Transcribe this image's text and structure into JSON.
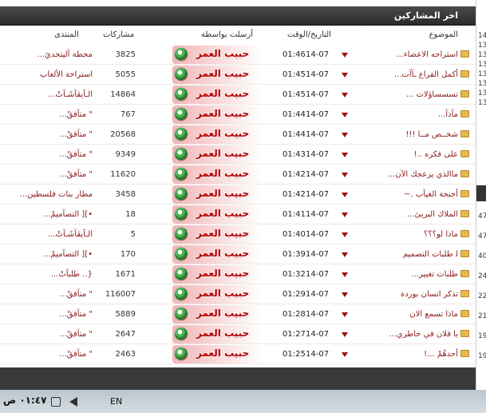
{
  "header": {
    "title": "اخر المشاركين"
  },
  "columns": {
    "topic": "الموضوع",
    "datetime": "التاريخ/الوقت",
    "sender": "أرسلت بواسطة",
    "posts": "مشاركات",
    "forum": "المنتدى"
  },
  "rows": [
    {
      "topic": "استراحه الاعضاء...",
      "date": "14-07",
      "time": "01:46",
      "user": "حبيب العمر",
      "posts": "3825",
      "forum": "محطة آليتجديَ..."
    },
    {
      "topic": "أكمل الفراغ ـآآت...",
      "date": "14-07",
      "time": "01:45",
      "user": "حبيب العمر",
      "posts": "5055",
      "forum": "استراحة الألعاب"
    },
    {
      "topic": "تسسساؤلات ...",
      "date": "14-07",
      "time": "01:45",
      "user": "حبيب العمر",
      "posts": "14864",
      "forum": "الـاَيڤآشَـآتْ..."
    },
    {
      "topic": "مآذآ...",
      "date": "14-07",
      "time": "01:44",
      "user": "حبيب العمر",
      "posts": "767",
      "forum": "\" متآفقْ..."
    },
    {
      "topic": "شخــص مــا !!!",
      "date": "14-07",
      "time": "01:44",
      "user": "حبيب العمر",
      "posts": "20568",
      "forum": "\" متآفقْ..."
    },
    {
      "topic": "على فكره ..!",
      "date": "14-07",
      "time": "01:43",
      "user": "حبيب العمر",
      "posts": "9349",
      "forum": "\" متآفقْ..."
    },
    {
      "topic": "ماالذي يزعجك الآن...",
      "date": "14-07",
      "time": "01:42",
      "user": "حبيب العمر",
      "posts": "11620",
      "forum": "\" متآفقْ..."
    },
    {
      "topic": "أجنحة الغيآب .~",
      "date": "14-07",
      "time": "01:42",
      "user": "حبيب العمر",
      "posts": "3458",
      "forum": "مطار بنات فلسطين..."
    },
    {
      "topic": "الملاك البريئ...",
      "date": "14-07",
      "time": "01:41",
      "user": "حبيب العمر",
      "posts": "18",
      "forum": "•][ التصآميمْ..."
    },
    {
      "topic": "ماذا لو؟؟؟",
      "date": "14-07",
      "time": "01:40",
      "user": "حبيب العمر",
      "posts": "5",
      "forum": "الـاَيڤآشَـآتْ..."
    },
    {
      "topic": "ﻟ طلبات التصميم",
      "date": "14-07",
      "time": "01:39",
      "user": "حبيب العمر",
      "posts": "170",
      "forum": "•][ التصآميمْ..."
    },
    {
      "topic": "طلبات تغيير...",
      "date": "14-07",
      "time": "01:32",
      "user": "حبيب العمر",
      "posts": "1671",
      "forum": "{.. طلبآتْ..."
    },
    {
      "topic": "تذكر انسان بوردة",
      "date": "14-07",
      "time": "01:29",
      "user": "حبيب العمر",
      "posts": "116007",
      "forum": "\" متآفقْ..."
    },
    {
      "topic": "ماذا تسمع الان",
      "date": "14-07",
      "time": "01:28",
      "user": "حبيب العمر",
      "posts": "5889",
      "forum": "\" متآفقْ..."
    },
    {
      "topic": "يا فلان في خاطري...",
      "date": "14-07",
      "time": "01:27",
      "user": "حبيب العمر",
      "posts": "2647",
      "forum": "\" متآفقْ..."
    },
    {
      "topic": "أحدهُمْ ...!",
      "date": "14-07",
      "time": "01:25",
      "user": "حبيب العمر",
      "posts": "2463",
      "forum": "\" متآفقْ..."
    }
  ],
  "right_panel": {
    "top_values": [
      "14",
      "13",
      "13",
      "13",
      "13",
      "13",
      "13",
      "13"
    ],
    "bottom_values": [
      "47",
      "47",
      "40",
      "24",
      "22",
      "21",
      "19",
      "19"
    ]
  },
  "taskbar": {
    "clock": "٠١:٤٧ ص",
    "language": "EN"
  },
  "colors": {
    "header_bg": "#3a3a3a",
    "link": "#8b1a1a",
    "user": "#b00000",
    "folder": "#e8b850"
  }
}
